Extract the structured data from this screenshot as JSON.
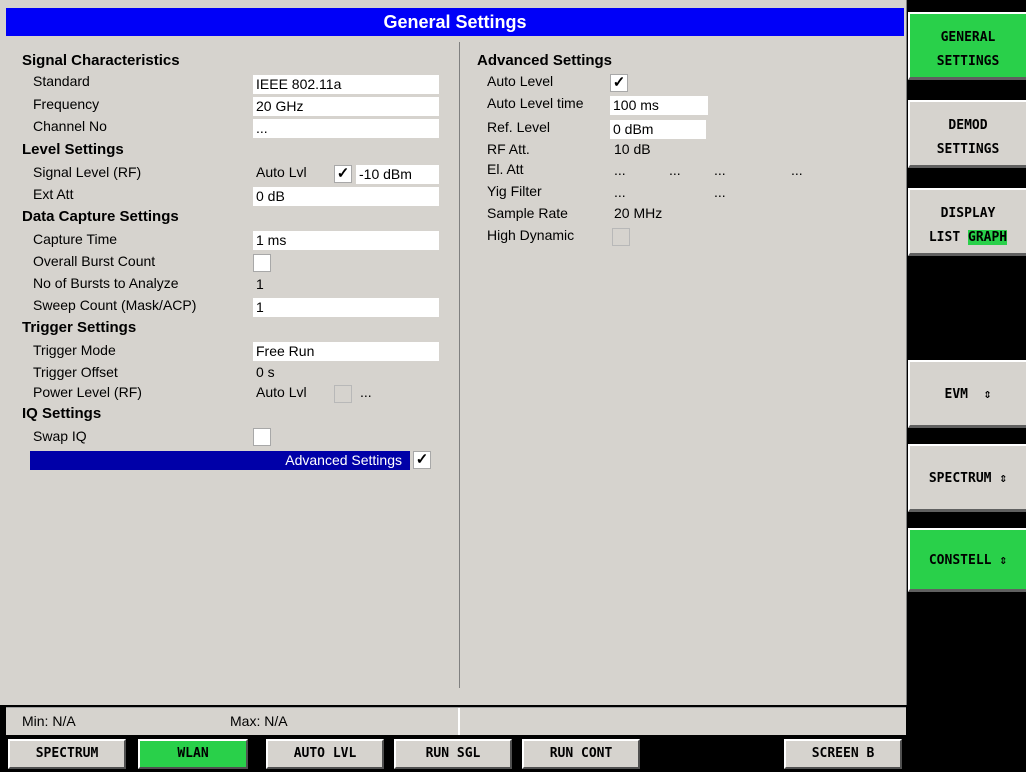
{
  "title": "General Settings",
  "left": {
    "signal_characteristics": {
      "header": "Signal Characteristics",
      "standard_label": "Standard",
      "standard_value": "IEEE 802.11a",
      "frequency_label": "Frequency",
      "frequency_value": "20 GHz",
      "channel_label": "Channel No",
      "channel_value": "..."
    },
    "level_settings": {
      "header": "Level Settings",
      "signal_level_label": "Signal Level (RF)",
      "signal_level_auto": "Auto Lvl",
      "signal_level_auto_checked": "✓",
      "signal_level_value": "-10 dBm",
      "ext_att_label": "Ext Att",
      "ext_att_value": "0 dB"
    },
    "data_capture": {
      "header": "Data Capture Settings",
      "capture_time_label": "Capture Time",
      "capture_time_value": "1 ms",
      "overall_burst_label": "Overall Burst Count",
      "bursts_analyze_label": "No of Bursts to Analyze",
      "bursts_analyze_value": "1",
      "sweep_count_label": "Sweep Count (Mask/ACP)",
      "sweep_count_value": "1"
    },
    "trigger_settings": {
      "header": "Trigger Settings",
      "trigger_mode_label": "Trigger Mode",
      "trigger_mode_value": "Free Run",
      "trigger_offset_label": "Trigger Offset",
      "trigger_offset_value": "0 s",
      "power_level_label": "Power Level (RF)",
      "power_level_auto": "Auto Lvl",
      "power_level_value": "..."
    },
    "iq_settings": {
      "header": "IQ Settings",
      "swap_iq_label": "Swap IQ"
    },
    "advanced_row": {
      "label": "Advanced Settings",
      "checked": "✓"
    }
  },
  "right": {
    "header": "Advanced Settings",
    "auto_level_label": "Auto Level",
    "auto_level_checked": "✓",
    "auto_level_time_label": "Auto Level time",
    "auto_level_time_value": "100 ms",
    "ref_level_label": "Ref. Level",
    "ref_level_value": "0 dBm",
    "rf_att_label": "RF Att.",
    "rf_att_value": "10 dB",
    "el_att_label": "El. Att",
    "el_att_v1": "...",
    "el_att_v2": "...",
    "el_att_v3": "...",
    "el_att_v4": "...",
    "yig_filter_label": "Yig Filter",
    "yig_filter_v1": "...",
    "yig_filter_v2": "...",
    "sample_rate_label": "Sample Rate",
    "sample_rate_value": "20 MHz",
    "high_dynamic_label": "High Dynamic"
  },
  "status": {
    "min": "Min: N/A",
    "max": "Max: N/A"
  },
  "softkeys": [
    {
      "line1": "GENERAL",
      "line2": "SETTINGS"
    },
    {
      "line1": "DEMOD",
      "line2": "SETTINGS"
    },
    {
      "line1": "DISPLAY",
      "line2a": "LIST",
      "line2b": "GRAPH"
    },
    {
      "line1": "EVM",
      "arrow": "⇕"
    },
    {
      "line1": "SPECTRUM",
      "arrow": "⇕"
    },
    {
      "line1": "CONSTELL",
      "arrow": "⇕"
    }
  ],
  "hotkeys": [
    "SPECTRUM",
    "WLAN",
    "AUTO LVL",
    "RUN SGL",
    "RUN CONT",
    "SCREEN B"
  ],
  "colors": {
    "title_bar": "#0000f8",
    "active_key": "#29d04a",
    "panel": "#d6d3ce",
    "selection": "#0000a8"
  }
}
